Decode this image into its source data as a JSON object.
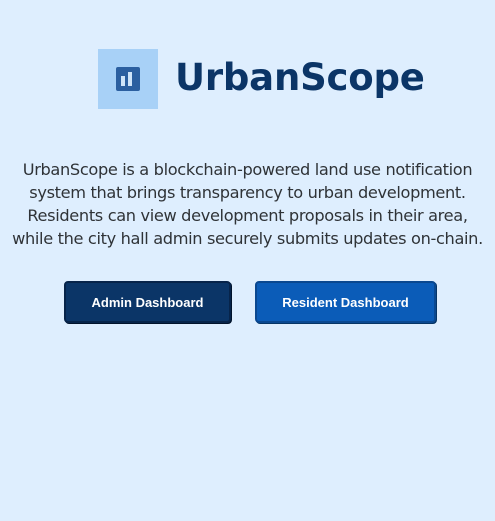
{
  "app": {
    "title": "UrbanScope",
    "logo_icon": "bar-chart-icon"
  },
  "intro": {
    "text": "UrbanScope is a blockchain-powered land use notification\nsystem that brings transparency to urban development.\nResidents can view development proposals in their area,\nwhile the city hall admin securely submits updates on-chain."
  },
  "actions": {
    "admin_label": "Admin Dashboard",
    "resident_label": "Resident Dashboard"
  },
  "colors": {
    "background": "#deeefe",
    "brand_dark": "#0b3567",
    "brand_blue": "#0b5cb8",
    "logo_bg": "#a8d1f7"
  }
}
